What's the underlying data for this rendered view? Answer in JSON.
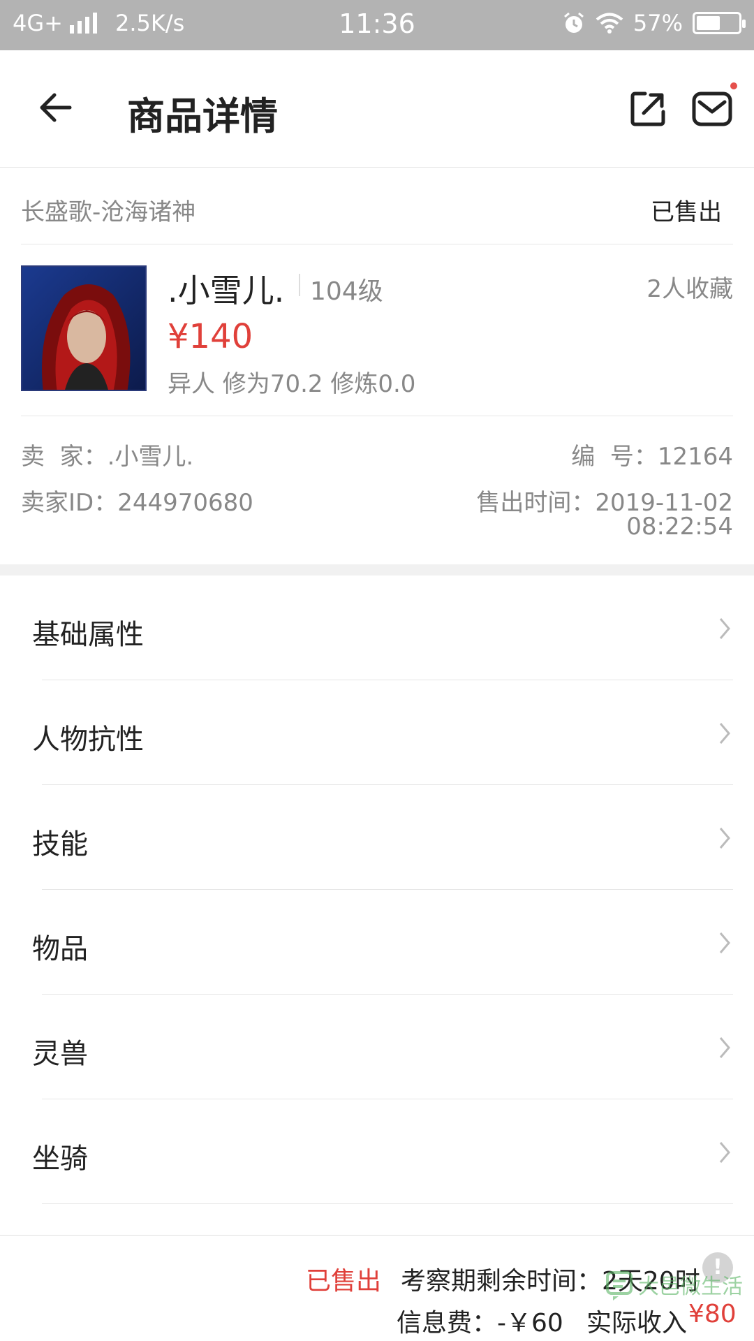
{
  "status_bar": {
    "network": "4G+",
    "speed": "2.5K/s",
    "time": "11:36",
    "battery_text": "57%",
    "battery_level": 0.57
  },
  "nav": {
    "title": "商品详情"
  },
  "listing": {
    "server": "长盛歌-沧海诸神",
    "status": "已售出"
  },
  "item": {
    "name": ".小雪儿.",
    "level": "104级",
    "favorites": "2人收藏",
    "price": "¥140",
    "attributes": "异人 修为70.2 修炼0.0"
  },
  "seller": {
    "seller_line": "卖  家：.小雪儿.",
    "seller_id_line": "卖家ID：244970680",
    "number_line": "编  号：12164",
    "sold_time_line": "售出时间：2019-11-02",
    "sold_time_clock": "08:22:54"
  },
  "menu": {
    "items": [
      {
        "label": "基础属性"
      },
      {
        "label": "人物抗性"
      },
      {
        "label": "技能"
      },
      {
        "label": "物品"
      },
      {
        "label": "灵兽"
      },
      {
        "label": "坐骑"
      }
    ]
  },
  "bottom": {
    "sold": "已售出",
    "remain_label": "考察期剩余时间：",
    "remain_value": "2天20时",
    "info_icon": "!",
    "fee": "信息费：-￥60",
    "income_label": "实际收入",
    "income_value": "¥80"
  },
  "watermark": {
    "text": "大邑微生活"
  },
  "colors": {
    "accent_red": "#e0403a",
    "status_bar_bg": "#b3b3b3"
  }
}
